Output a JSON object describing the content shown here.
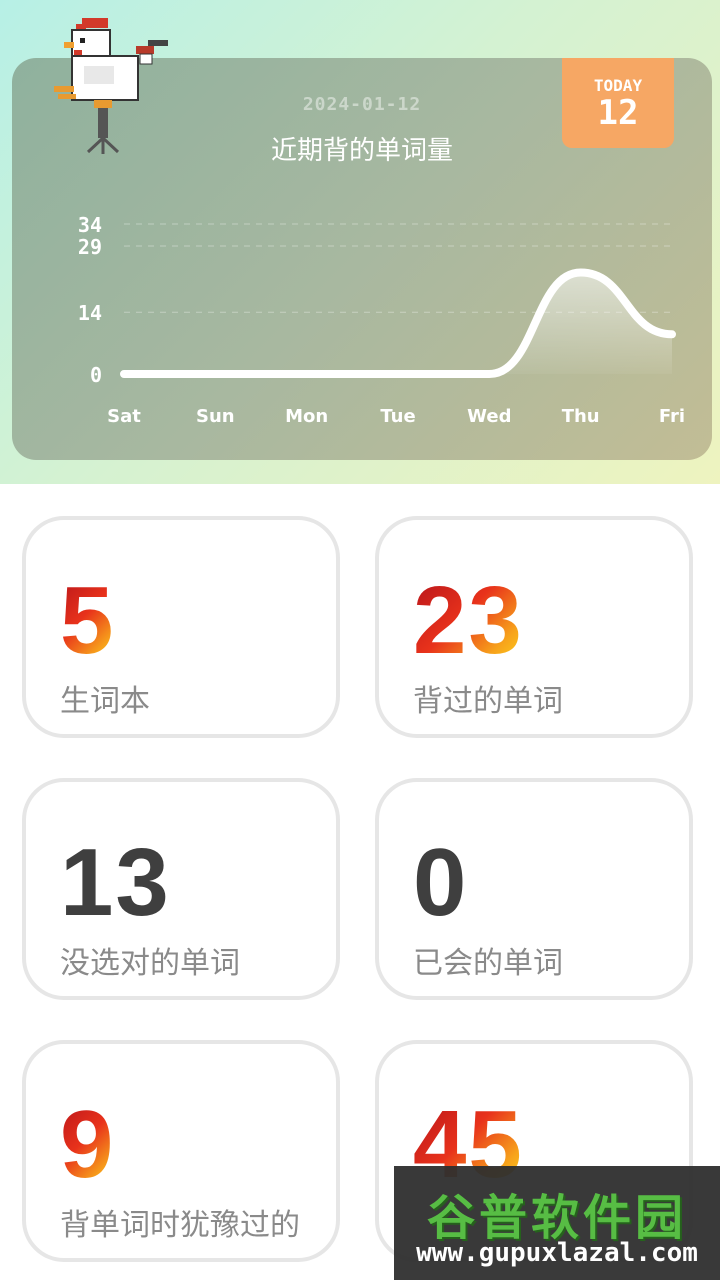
{
  "header": {
    "date": "2024-01-12",
    "title": "近期背的单词量",
    "today_label": "TODAY",
    "today_value": "12"
  },
  "chart_data": {
    "type": "area",
    "title": "近期背的单词量",
    "categories": [
      "Sat",
      "Sun",
      "Mon",
      "Tue",
      "Wed",
      "Thu",
      "Fri"
    ],
    "series": [
      {
        "values": [
          0,
          0,
          0,
          0,
          0,
          23,
          9
        ]
      }
    ],
    "y_ticks": [
      0,
      14,
      29,
      34
    ],
    "ylim": [
      0,
      34
    ],
    "grid": true,
    "colors": {
      "line": "#ffffff",
      "grid": "rgba(255,255,255,0.35)"
    }
  },
  "stats": [
    {
      "value": "5",
      "label": "生词本",
      "style": "gradient"
    },
    {
      "value": "23",
      "label": "背过的单词",
      "style": "gradient"
    },
    {
      "value": "13",
      "label": "没选对的单词",
      "style": "dark"
    },
    {
      "value": "0",
      "label": "已会的单词",
      "style": "dark"
    },
    {
      "value": "9",
      "label": "背单词时犹豫过的",
      "style": "gradient"
    },
    {
      "value": "45",
      "label": "",
      "style": "gradient"
    }
  ],
  "watermark": {
    "title": "谷普软件园",
    "url": "www.gupuxlazal.com"
  }
}
